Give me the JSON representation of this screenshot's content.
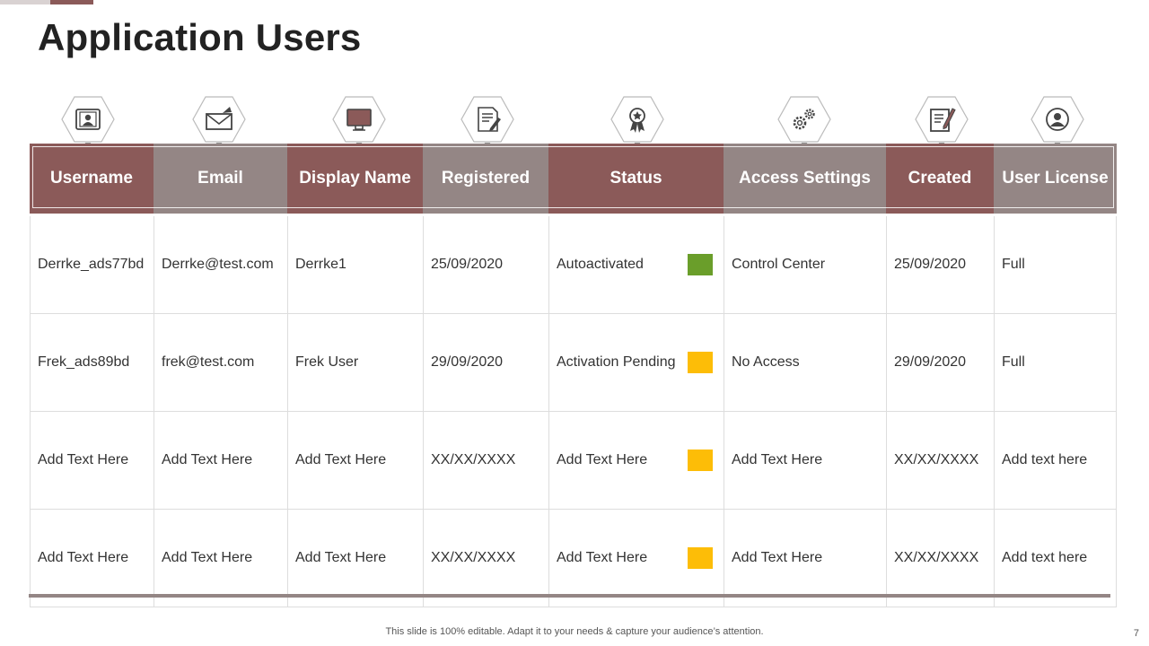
{
  "title": "Application Users",
  "colors": {
    "header_dark": "#8b5a59",
    "header_light": "#948685",
    "status_green": "#6a9e2a",
    "status_yellow": "#fdbd07"
  },
  "columns": [
    {
      "label": "Username",
      "icon": "id-card-icon",
      "tone": "dark"
    },
    {
      "label": "Email",
      "icon": "envelope-icon",
      "tone": "light"
    },
    {
      "label": "Display Name",
      "icon": "monitor-icon",
      "tone": "dark"
    },
    {
      "label": "Registered",
      "icon": "document-pen-icon",
      "tone": "light"
    },
    {
      "label": "Status",
      "icon": "award-badge-icon",
      "tone": "dark"
    },
    {
      "label": "Access Settings",
      "icon": "gears-icon",
      "tone": "light"
    },
    {
      "label": "Created",
      "icon": "notepad-pencil-icon",
      "tone": "dark"
    },
    {
      "label": "User License",
      "icon": "user-circle-icon",
      "tone": "light"
    }
  ],
  "rows": [
    {
      "username": "Derrke_ads77bd",
      "email": "Derrke@test.com",
      "display_name": "Derrke1",
      "registered": "25/09/2020",
      "status": "Autoactivated",
      "status_color": "green",
      "access": "Control Center",
      "created": "25/09/2020",
      "license": "Full"
    },
    {
      "username": "Frek_ads89bd",
      "email": "frek@test.com",
      "display_name": "Frek User",
      "registered": "29/09/2020",
      "status": "Activation Pending",
      "status_color": "yellow",
      "access": "No Access",
      "created": "29/09/2020",
      "license": "Full"
    },
    {
      "username": "Add Text Here",
      "email": "Add Text Here",
      "display_name": "Add Text Here",
      "registered": "XX/XX/XXXX",
      "status": "Add Text Here",
      "status_color": "yellow",
      "access": "Add Text Here",
      "created": "XX/XX/XXXX",
      "license": "Add text here"
    },
    {
      "username": "Add Text Here",
      "email": "Add Text Here",
      "display_name": "Add Text Here",
      "registered": "XX/XX/XXXX",
      "status": "Add Text Here",
      "status_color": "yellow",
      "access": "Add Text Here",
      "created": "XX/XX/XXXX",
      "license": "Add text here"
    }
  ],
  "footer": "This slide is 100% editable. Adapt it to your needs & capture your audience’s attention.",
  "page_number": "7"
}
